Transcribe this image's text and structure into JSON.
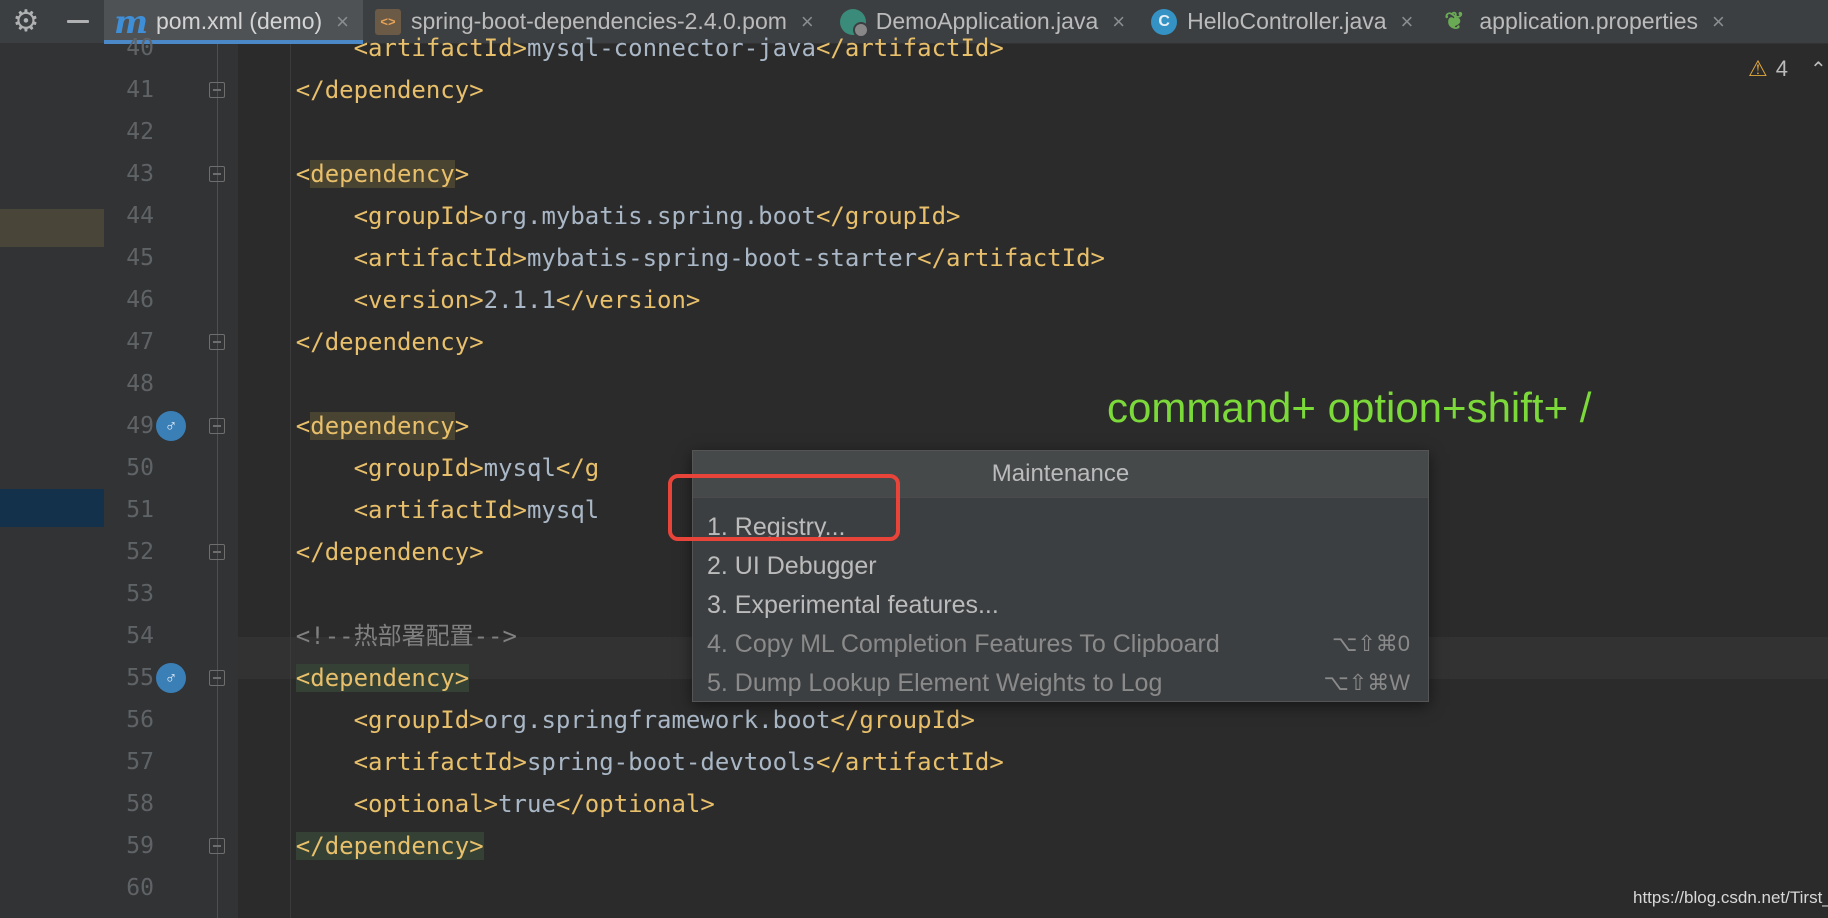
{
  "tabs": [
    {
      "label": "pom.xml (demo)",
      "icon": "maven-icon",
      "active": true
    },
    {
      "label": "spring-boot-dependencies-2.4.0.pom",
      "icon": "xml-file-icon",
      "active": false
    },
    {
      "label": "DemoApplication.java",
      "icon": "spring-class-icon",
      "active": false
    },
    {
      "label": "HelloController.java",
      "icon": "class-icon",
      "active": false
    },
    {
      "label": "application.properties",
      "icon": "spring-leaf-icon",
      "active": false
    }
  ],
  "icon_glyphs": {
    "maven": "m",
    "xml": "<>",
    "class": "C",
    "close": "×",
    "gear": "⚙",
    "warning": "⚠"
  },
  "lines": [
    {
      "n": "40",
      "seg": [
        [
          "tag",
          "        <artifactId>"
        ],
        [
          "txt",
          "mysql-connector-java"
        ],
        [
          "tag",
          "</artifactId>"
        ]
      ]
    },
    {
      "n": "41",
      "seg": [
        [
          "tag",
          "    </dependency>"
        ]
      ]
    },
    {
      "n": "42",
      "seg": []
    },
    {
      "n": "43",
      "seg": [
        [
          "tag",
          "    <"
        ],
        [
          "dep",
          "dependency"
        ],
        [
          "tag",
          ">"
        ]
      ]
    },
    {
      "n": "44",
      "seg": [
        [
          "tag",
          "        <groupId>"
        ],
        [
          "txt",
          "org.mybatis.spring.boot"
        ],
        [
          "tag",
          "</groupId>"
        ]
      ]
    },
    {
      "n": "45",
      "seg": [
        [
          "tag",
          "        <artifactId>"
        ],
        [
          "txt",
          "mybatis-spring-boot-starter"
        ],
        [
          "tag",
          "</artifactId>"
        ]
      ]
    },
    {
      "n": "46",
      "seg": [
        [
          "tag",
          "        <version>"
        ],
        [
          "txt",
          "2.1.1"
        ],
        [
          "tag",
          "</version>"
        ]
      ]
    },
    {
      "n": "47",
      "seg": [
        [
          "tag",
          "    </dependency>"
        ]
      ]
    },
    {
      "n": "48",
      "seg": []
    },
    {
      "n": "49",
      "seg": [
        [
          "tag",
          "    <"
        ],
        [
          "dep",
          "dependency"
        ],
        [
          "tag",
          ">"
        ]
      ]
    },
    {
      "n": "50",
      "seg": [
        [
          "tag",
          "        <groupId>"
        ],
        [
          "txt",
          "mysql"
        ],
        [
          "tag",
          "</g"
        ]
      ]
    },
    {
      "n": "51",
      "seg": [
        [
          "tag",
          "        <artifactId>"
        ],
        [
          "txt",
          "mysql"
        ]
      ]
    },
    {
      "n": "52",
      "seg": [
        [
          "tag",
          "    </dependency>"
        ]
      ]
    },
    {
      "n": "53",
      "seg": []
    },
    {
      "n": "54",
      "seg": [
        [
          "cmt",
          "    <!--热部署配置-->"
        ]
      ]
    },
    {
      "n": "55",
      "seg": [
        [
          "tag",
          "    "
        ],
        [
          "dep2",
          "<dependency>"
        ]
      ]
    },
    {
      "n": "56",
      "seg": [
        [
          "tag",
          "        <groupId>"
        ],
        [
          "txt",
          "org.springframework.boot"
        ],
        [
          "tag",
          "</groupId>"
        ]
      ]
    },
    {
      "n": "57",
      "seg": [
        [
          "tag",
          "        <artifactId>"
        ],
        [
          "txt",
          "spring-boot-devtools"
        ],
        [
          "tag",
          "</artifactId>"
        ]
      ]
    },
    {
      "n": "58",
      "seg": [
        [
          "tag",
          "        <optional>"
        ],
        [
          "txt",
          "true"
        ],
        [
          "tag",
          "</optional>"
        ]
      ]
    },
    {
      "n": "59",
      "seg": [
        [
          "tag",
          "    "
        ],
        [
          "dep2",
          "</dependency>"
        ]
      ]
    },
    {
      "n": "60",
      "seg": []
    }
  ],
  "warnings": {
    "count": "4"
  },
  "annotation": "command+ option+shift+ /",
  "popup": {
    "title": "Maintenance",
    "items": [
      {
        "label": "1. Registry...",
        "shortcut": "",
        "enabled": true
      },
      {
        "label": "2. UI Debugger",
        "shortcut": "",
        "enabled": true
      },
      {
        "label": "3. Experimental features...",
        "shortcut": "",
        "enabled": true
      },
      {
        "label": "4. Copy ML Completion Features To Clipboard",
        "shortcut": "⌥⇧⌘0",
        "enabled": false
      },
      {
        "label": "5. Dump Lookup Element Weights to Log",
        "shortcut": "⌥⇧⌘W",
        "enabled": false
      }
    ]
  },
  "watermark": "https://blog.csdn.net/Tirst_",
  "colors": {
    "tag": "#e8bf6a",
    "text": "#a9b7c6",
    "comment": "#808080",
    "annotation": "#7cd93a",
    "highlight_box": "#e8443a"
  }
}
